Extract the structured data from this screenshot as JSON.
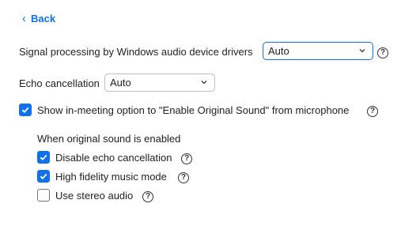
{
  "nav": {
    "back_label": "Back"
  },
  "signal_processing": {
    "label": "Signal processing by Windows audio device drivers",
    "value": "Auto"
  },
  "echo_cancellation": {
    "label": "Echo cancellation",
    "value": "Auto"
  },
  "original_sound_option": {
    "label": "Show in-meeting option to \"Enable Original Sound\" from microphone",
    "checked": true
  },
  "original_sound_section": {
    "heading": "When original sound is enabled",
    "options": [
      {
        "label": "Disable echo cancellation",
        "checked": true
      },
      {
        "label": "High fidelity music mode",
        "checked": true
      },
      {
        "label": "Use stereo audio",
        "checked": false
      }
    ]
  },
  "help_glyph": "?",
  "colors": {
    "accent": "#0e72ed",
    "text": "#222222",
    "border": "#bdbdc4"
  }
}
